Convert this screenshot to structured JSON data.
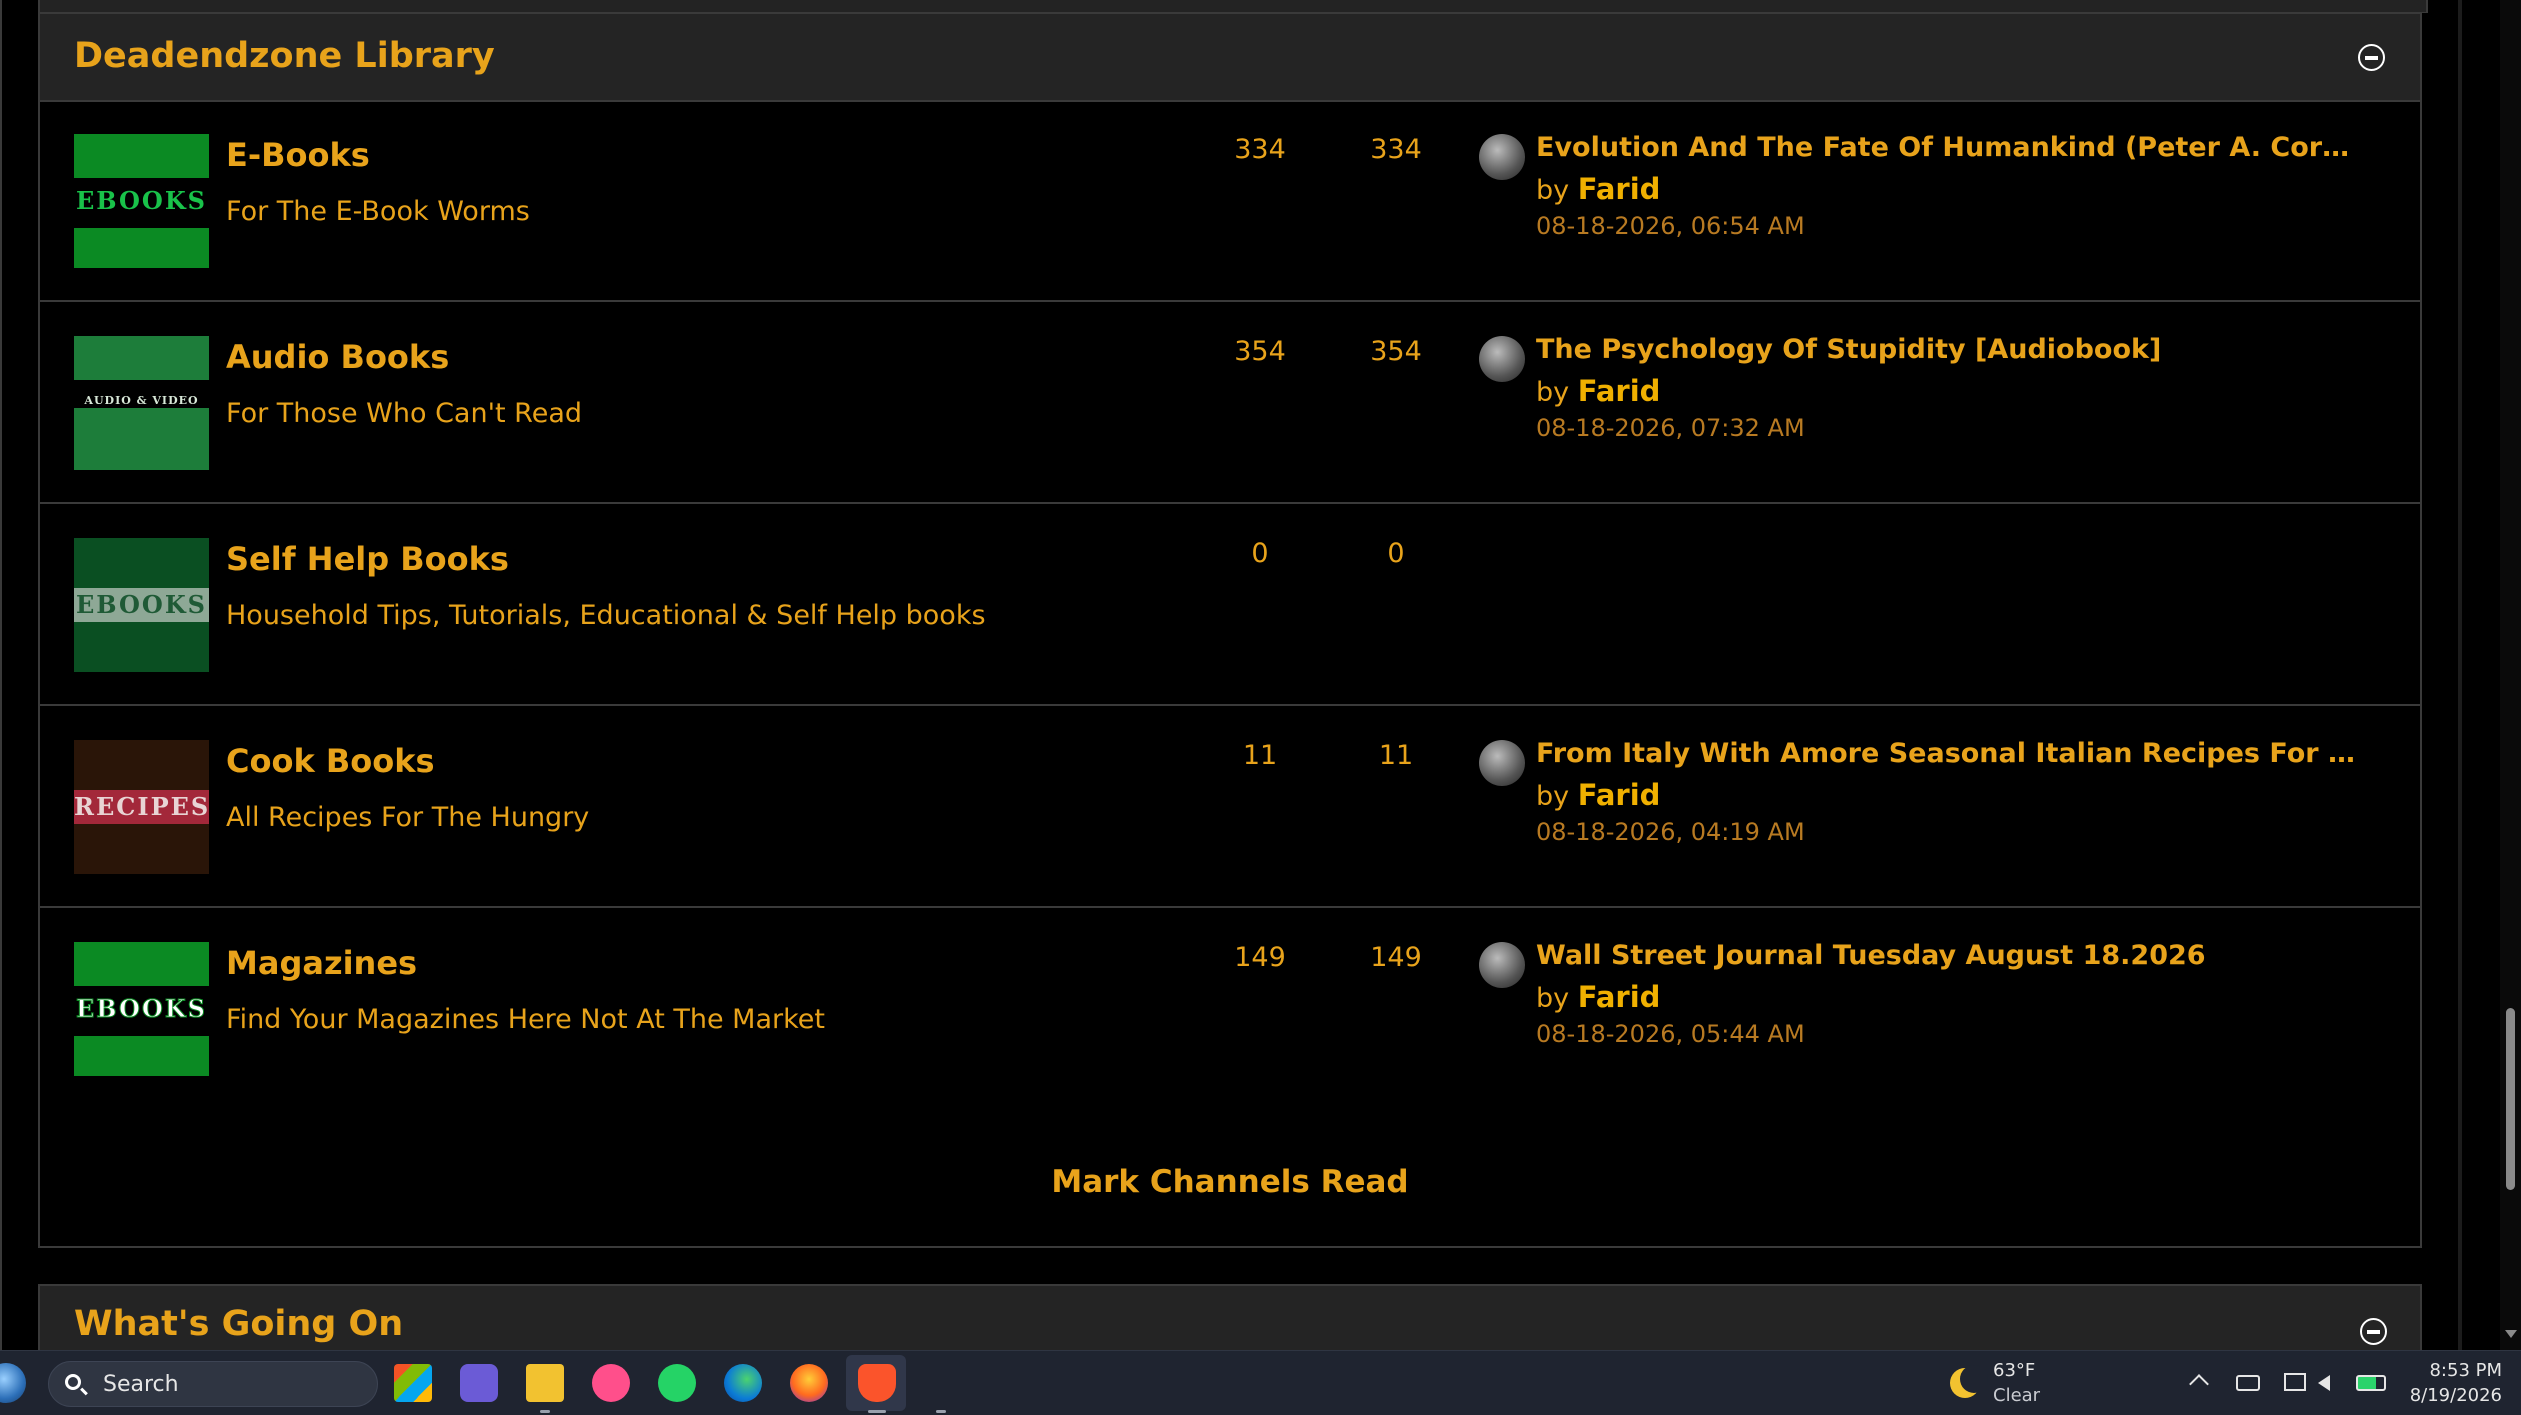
{
  "library": {
    "title": "Deadendzone Library",
    "forums": [
      {
        "thumb_text": "EBOOKS",
        "thumb_colors": {
          "top": "#0b8a23",
          "bottom": "#0b8a23",
          "text": "#19c24a"
        },
        "name": "E-Books",
        "description": "For The E-Book Worms",
        "threads": "334",
        "posts": "334",
        "last_title": "Evolution And The Fate Of Humankind (Peter A. Corning)",
        "last_by": "by",
        "last_user": "Farid",
        "last_date": "08-18-2026, 06:54 AM"
      },
      {
        "thumb_text": "AUDIO & VIDEO",
        "thumb_colors": {
          "top": "#1d7d3a",
          "bottom": "#1d7d3a",
          "text": "#d8e8d8"
        },
        "name": "Audio Books",
        "description": "For Those Who Can't Read",
        "threads": "354",
        "posts": "354",
        "last_title": "The Psychology Of Stupidity [Audiobook]",
        "last_by": "by",
        "last_user": "Farid",
        "last_date": "08-18-2026, 07:32 AM"
      },
      {
        "thumb_text": "EBOOKS",
        "thumb_colors": {
          "top": "#0a4f22",
          "bottom": "#0a4f22",
          "text": "#1f5a36"
        },
        "name": "Self Help Books",
        "description": "Household Tips, Tutorials, Educational & Self Help books",
        "threads": "0",
        "posts": "0",
        "last_title": "",
        "last_by": "",
        "last_user": "",
        "last_date": ""
      },
      {
        "thumb_text": "RECIPES",
        "thumb_colors": {
          "top": "#2a1508",
          "bottom": "#2a1508",
          "text": "#e8d4d4"
        },
        "name": "Cook Books",
        "description": "All Recipes For The Hungry",
        "threads": "11",
        "posts": "11",
        "last_title": "From Italy With Amore Seasonal Italian Recipes For Those You …",
        "last_by": "by",
        "last_user": "Farid",
        "last_date": "08-18-2026, 04:19 AM"
      },
      {
        "thumb_text": "EBOOKS",
        "thumb_colors": {
          "top": "#0b8a23",
          "bottom": "#0b8a23",
          "text": "#ffffff"
        },
        "name": "Magazines",
        "description": "Find Your Magazines Here Not At The Market",
        "threads": "149",
        "posts": "149",
        "last_title": "Wall Street Journal Tuesday August 18.2026",
        "last_by": "by",
        "last_user": "Farid",
        "last_date": "08-18-2026, 05:44 AM"
      }
    ],
    "mark_read_label": "Mark Channels Read"
  },
  "whats_going_on": {
    "title": "What's Going On"
  },
  "taskbar": {
    "search_label": "Search",
    "weather_temp": "63°F",
    "weather_condition": "Clear",
    "time": "8:53 PM",
    "date": "8/19/2026"
  },
  "colors": {
    "accent": "#e8a31b",
    "header_bg": "#242424",
    "page_bg": "#000000",
    "border": "#3a3a3a",
    "taskbar_bg": "#1f2430"
  }
}
